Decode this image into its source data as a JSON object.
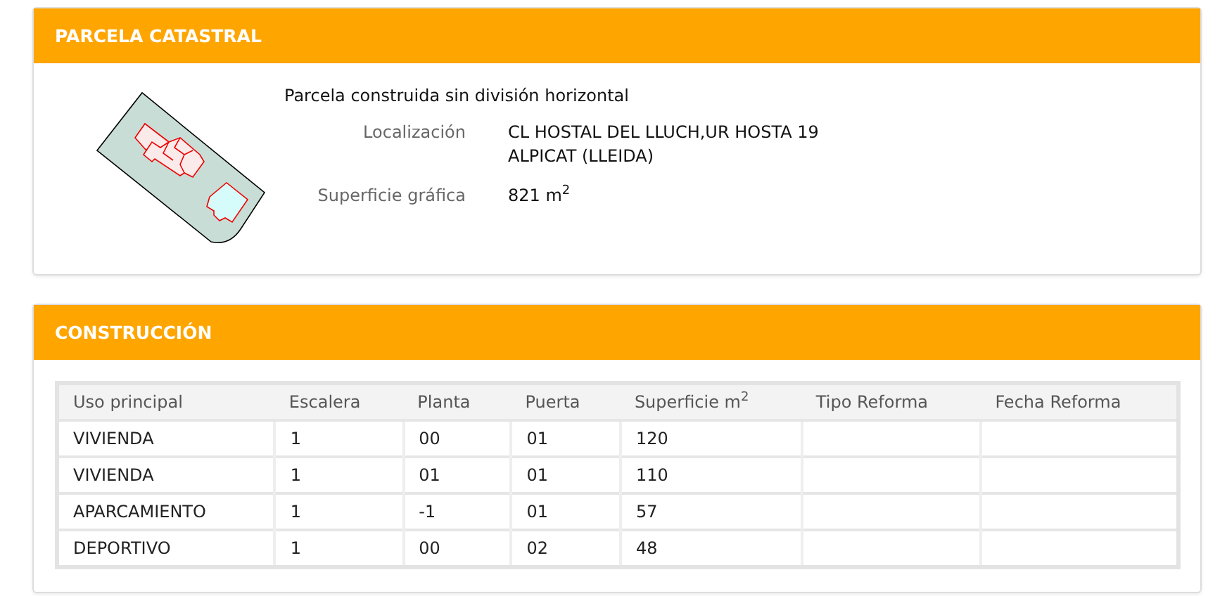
{
  "parcel": {
    "title": "PARCELA CATASTRAL",
    "description": "Parcela construida sin división horizontal",
    "fields": [
      {
        "label": "Localización",
        "lines": [
          "CL HOSTAL DEL LLUCH,UR HOSTA 19",
          "ALPICAT (LLEIDA)"
        ]
      },
      {
        "label": "Superficie gráfica",
        "lines": [
          "821 m$^{2}$"
        ]
      }
    ]
  },
  "construction": {
    "title": "CONSTRUCCIÓN",
    "table": {
      "columns": [
        "Uso principal",
        "Escalera",
        "Planta",
        "Puerta",
        "Superficie m$^{2}$",
        "Tipo Reforma",
        "Fecha Reforma"
      ],
      "rows": [
        [
          "VIVIENDA",
          "1",
          "00",
          "01",
          "120",
          "",
          ""
        ],
        [
          "VIVIENDA",
          "1",
          "01",
          "01",
          "110",
          "",
          ""
        ],
        [
          "APARCAMIENTO",
          "1",
          "-1",
          "01",
          "57",
          "",
          ""
        ],
        [
          "DEPORTIVO",
          "1",
          "00",
          "02",
          "48",
          "",
          ""
        ]
      ]
    }
  }
}
